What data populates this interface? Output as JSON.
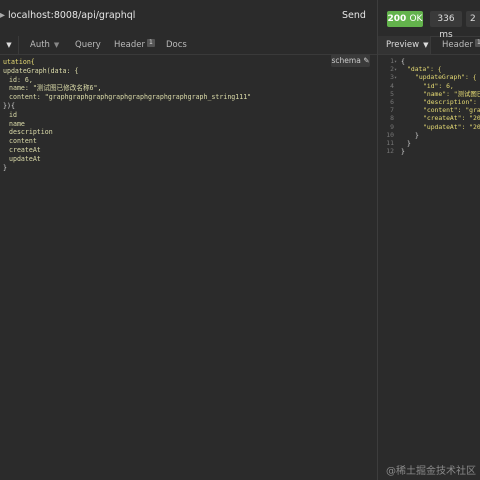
{
  "request": {
    "url": "localhost:8008/api/graphql",
    "send_label": "Send"
  },
  "response_meta": {
    "status_code": "200",
    "status_text": "OK",
    "time": "336 ms",
    "size": "2"
  },
  "tabs": {
    "auth": "Auth",
    "query": "Query",
    "header": "Header",
    "header_count": "1",
    "docs": "Docs",
    "schema_label": "schema"
  },
  "rtabs": {
    "preview": "Preview",
    "header": "Header",
    "header_count": "16"
  },
  "query_lines": [
    "utation{",
    "updateGraph(data: {",
    "id: 6,",
    "name: \"测试图已修改名称6\",",
    "content: \"graphgraphgraphgraphgraphgraphgraphgraph_string111\"",
    "}){",
    "id",
    "name",
    "description",
    "content",
    "createAt",
    "updateAt",
    "}"
  ],
  "response_lines": [
    "{",
    "\"data\": {",
    "\"updateGraph\": {",
    "\"id\": 6,",
    "\"name\": \"测试图已修",
    "\"description\": \"",
    "\"content\": \"graph",
    "\"createAt\": \"2021",
    "\"updateAt\": \"2021",
    "}",
    "}",
    "}"
  ],
  "response_line_numbers": [
    "1",
    "2",
    "3",
    "4",
    "5",
    "6",
    "7",
    "8",
    "9",
    "10",
    "11",
    "12"
  ],
  "watermark": "@稀土掘金技术社区",
  "colors": {
    "status_ok": "#63b34c",
    "background": "#2b2b2b"
  }
}
